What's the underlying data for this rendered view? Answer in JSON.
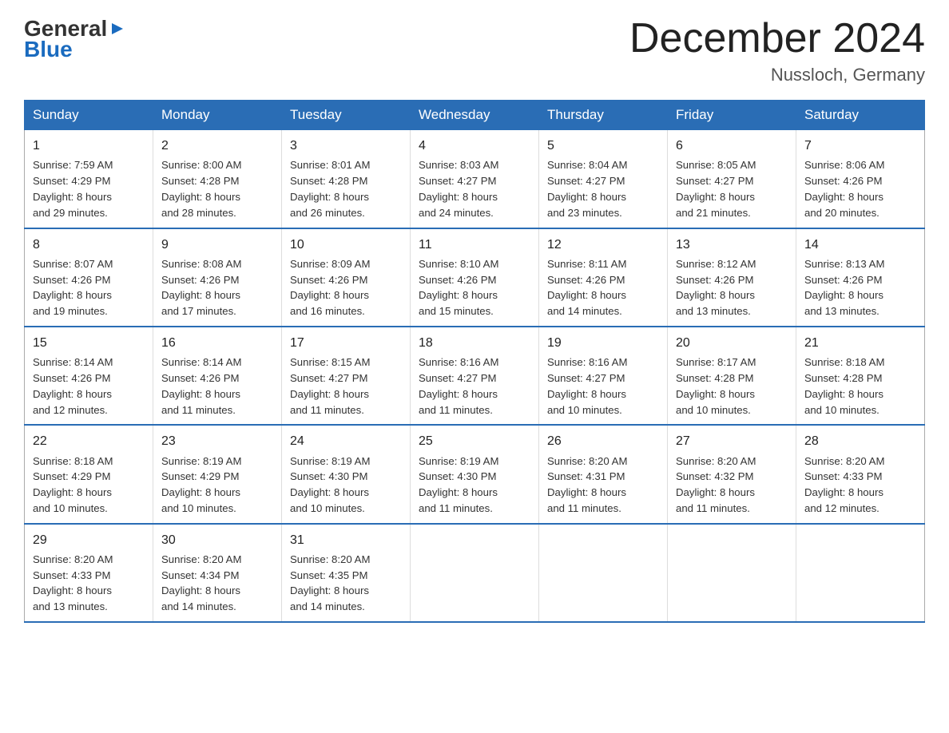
{
  "header": {
    "logo_general": "General",
    "logo_blue": "Blue",
    "month_title": "December 2024",
    "location": "Nussloch, Germany"
  },
  "weekdays": [
    "Sunday",
    "Monday",
    "Tuesday",
    "Wednesday",
    "Thursday",
    "Friday",
    "Saturday"
  ],
  "weeks": [
    [
      {
        "day": "1",
        "sunrise": "7:59 AM",
        "sunset": "4:29 PM",
        "daylight": "8 hours and 29 minutes."
      },
      {
        "day": "2",
        "sunrise": "8:00 AM",
        "sunset": "4:28 PM",
        "daylight": "8 hours and 28 minutes."
      },
      {
        "day": "3",
        "sunrise": "8:01 AM",
        "sunset": "4:28 PM",
        "daylight": "8 hours and 26 minutes."
      },
      {
        "day": "4",
        "sunrise": "8:03 AM",
        "sunset": "4:27 PM",
        "daylight": "8 hours and 24 minutes."
      },
      {
        "day": "5",
        "sunrise": "8:04 AM",
        "sunset": "4:27 PM",
        "daylight": "8 hours and 23 minutes."
      },
      {
        "day": "6",
        "sunrise": "8:05 AM",
        "sunset": "4:27 PM",
        "daylight": "8 hours and 21 minutes."
      },
      {
        "day": "7",
        "sunrise": "8:06 AM",
        "sunset": "4:26 PM",
        "daylight": "8 hours and 20 minutes."
      }
    ],
    [
      {
        "day": "8",
        "sunrise": "8:07 AM",
        "sunset": "4:26 PM",
        "daylight": "8 hours and 19 minutes."
      },
      {
        "day": "9",
        "sunrise": "8:08 AM",
        "sunset": "4:26 PM",
        "daylight": "8 hours and 17 minutes."
      },
      {
        "day": "10",
        "sunrise": "8:09 AM",
        "sunset": "4:26 PM",
        "daylight": "8 hours and 16 minutes."
      },
      {
        "day": "11",
        "sunrise": "8:10 AM",
        "sunset": "4:26 PM",
        "daylight": "8 hours and 15 minutes."
      },
      {
        "day": "12",
        "sunrise": "8:11 AM",
        "sunset": "4:26 PM",
        "daylight": "8 hours and 14 minutes."
      },
      {
        "day": "13",
        "sunrise": "8:12 AM",
        "sunset": "4:26 PM",
        "daylight": "8 hours and 13 minutes."
      },
      {
        "day": "14",
        "sunrise": "8:13 AM",
        "sunset": "4:26 PM",
        "daylight": "8 hours and 13 minutes."
      }
    ],
    [
      {
        "day": "15",
        "sunrise": "8:14 AM",
        "sunset": "4:26 PM",
        "daylight": "8 hours and 12 minutes."
      },
      {
        "day": "16",
        "sunrise": "8:14 AM",
        "sunset": "4:26 PM",
        "daylight": "8 hours and 11 minutes."
      },
      {
        "day": "17",
        "sunrise": "8:15 AM",
        "sunset": "4:27 PM",
        "daylight": "8 hours and 11 minutes."
      },
      {
        "day": "18",
        "sunrise": "8:16 AM",
        "sunset": "4:27 PM",
        "daylight": "8 hours and 11 minutes."
      },
      {
        "day": "19",
        "sunrise": "8:16 AM",
        "sunset": "4:27 PM",
        "daylight": "8 hours and 10 minutes."
      },
      {
        "day": "20",
        "sunrise": "8:17 AM",
        "sunset": "4:28 PM",
        "daylight": "8 hours and 10 minutes."
      },
      {
        "day": "21",
        "sunrise": "8:18 AM",
        "sunset": "4:28 PM",
        "daylight": "8 hours and 10 minutes."
      }
    ],
    [
      {
        "day": "22",
        "sunrise": "8:18 AM",
        "sunset": "4:29 PM",
        "daylight": "8 hours and 10 minutes."
      },
      {
        "day": "23",
        "sunrise": "8:19 AM",
        "sunset": "4:29 PM",
        "daylight": "8 hours and 10 minutes."
      },
      {
        "day": "24",
        "sunrise": "8:19 AM",
        "sunset": "4:30 PM",
        "daylight": "8 hours and 10 minutes."
      },
      {
        "day": "25",
        "sunrise": "8:19 AM",
        "sunset": "4:30 PM",
        "daylight": "8 hours and 11 minutes."
      },
      {
        "day": "26",
        "sunrise": "8:20 AM",
        "sunset": "4:31 PM",
        "daylight": "8 hours and 11 minutes."
      },
      {
        "day": "27",
        "sunrise": "8:20 AM",
        "sunset": "4:32 PM",
        "daylight": "8 hours and 11 minutes."
      },
      {
        "day": "28",
        "sunrise": "8:20 AM",
        "sunset": "4:33 PM",
        "daylight": "8 hours and 12 minutes."
      }
    ],
    [
      {
        "day": "29",
        "sunrise": "8:20 AM",
        "sunset": "4:33 PM",
        "daylight": "8 hours and 13 minutes."
      },
      {
        "day": "30",
        "sunrise": "8:20 AM",
        "sunset": "4:34 PM",
        "daylight": "8 hours and 14 minutes."
      },
      {
        "day": "31",
        "sunrise": "8:20 AM",
        "sunset": "4:35 PM",
        "daylight": "8 hours and 14 minutes."
      },
      null,
      null,
      null,
      null
    ]
  ],
  "labels": {
    "sunrise": "Sunrise:",
    "sunset": "Sunset:",
    "daylight": "Daylight:"
  }
}
